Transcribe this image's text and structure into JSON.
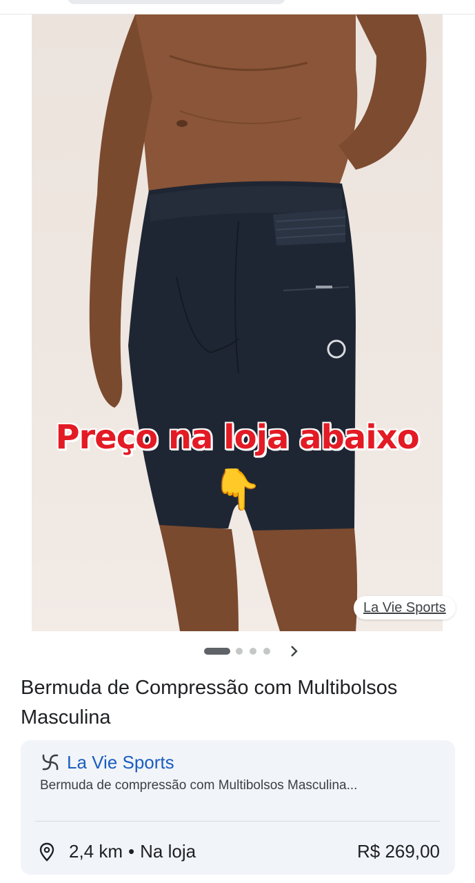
{
  "product": {
    "overlay_text": "Preço na loja abaixo",
    "overlay_emoji": "👇",
    "image_source": "La Vie Sports",
    "title": "Bermuda de Compressão com Multibolsos Masculina"
  },
  "carousel": {
    "current_index": 1,
    "total": 4,
    "next_icon": "chevron-right-icon"
  },
  "store": {
    "name": "La Vie Sports",
    "logo_icon": "swirl-logo-icon",
    "description": "Bermuda de compressão com Multibolsos Masculina...",
    "distance": "2,4 km",
    "separator": "•",
    "availability": "Na loja",
    "price": "R$ 269,00",
    "location_icon": "location-pin-icon"
  },
  "colors": {
    "overlay_red": "#e31b25",
    "store_link": "#1a5dc0",
    "card_bg": "#f1f4f8"
  }
}
